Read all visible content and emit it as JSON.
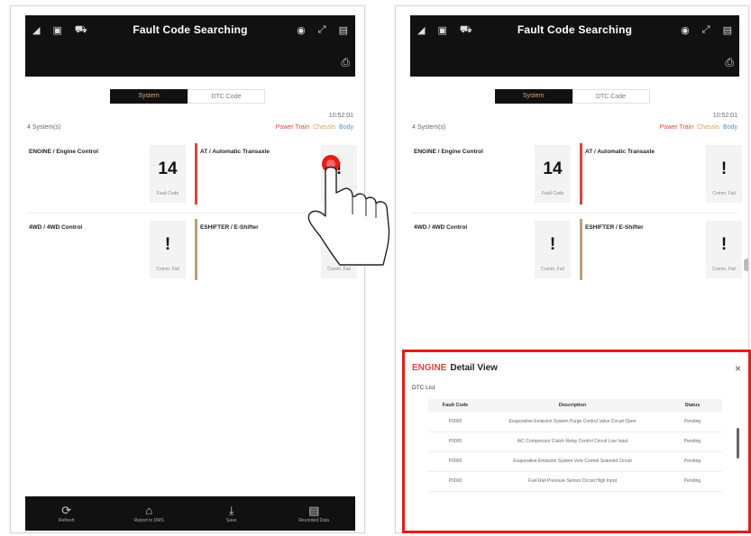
{
  "left_screen": {
    "title": "Fault Code Searching",
    "tabs": [
      {
        "label": "System"
      },
      {
        "label": "DTC Code"
      }
    ],
    "time": "10:52:01",
    "system_count": "4 System(s)",
    "filters": {
      "power": "Power Train",
      "chassis": "Chassis",
      "body": "Body"
    },
    "cards": [
      {
        "name": "ENGINE / Engine Control",
        "value": "14",
        "sub": "Fault Code"
      },
      {
        "name": "AT / Automatic Transaxle",
        "value": "!",
        "sub": "Comm. Fail"
      },
      {
        "name": "4WD / 4WD Control",
        "value": "!",
        "sub": "Comm. Fail"
      },
      {
        "name": "ESHIFTER / E-Shifter",
        "value": "!",
        "sub": "Comm. Fail"
      }
    ],
    "nav": [
      {
        "label": "Refresh"
      },
      {
        "label": "Report to DMS"
      },
      {
        "label": "Save"
      },
      {
        "label": "Recorded Data"
      }
    ]
  },
  "right_screen": {
    "title": "Fault Code Searching",
    "tabs": [
      {
        "label": "System"
      },
      {
        "label": "DTC Code"
      }
    ],
    "time": "10:52:01",
    "system_count": "4 System(s)",
    "filters": {
      "power": "Power Train",
      "chassis": "Chassis",
      "body": "Body"
    },
    "cards": [
      {
        "name": "ENGINE / Engine Control",
        "value": "14",
        "sub": "Fault Code"
      },
      {
        "name": "AT / Automatic Transaxle",
        "value": "!",
        "sub": "Comm. Fail"
      },
      {
        "name": "4WD / 4WD Control",
        "value": "!",
        "sub": "Comm. Fail"
      },
      {
        "name": "ESHIFTER / E-Shifter",
        "value": "!",
        "sub": "Comm. Fail"
      }
    ]
  },
  "detail": {
    "engine_label": "ENGINE",
    "title": "Detail View",
    "close": "×",
    "dtc_list_label": "DTC List",
    "columns": [
      "Fault Code",
      "Description",
      "Status"
    ],
    "rows": [
      {
        "code": "P0000",
        "desc": "Evaporative Emission System Purge Control Valve Circuit Open",
        "status": "Pending"
      },
      {
        "code": "P0000",
        "desc": "A/C Compressor Clutch Relay Control Circuit Low Input",
        "status": "Pending"
      },
      {
        "code": "P0000",
        "desc": "Evaporative Emission System Vent Control Solenoid Circuit",
        "status": "Pending"
      },
      {
        "code": "P0000",
        "desc": "Fuel Rail Pressure Sensor Circuit High Input",
        "status": "Pending"
      }
    ]
  },
  "colors": {
    "red_bar": "#d9463e",
    "tan_bar": "#b8a07a",
    "highlight_frame": "#e51c16",
    "power_train": "#d9463e",
    "chassis": "#c9a45c",
    "body": "#4a90c2"
  }
}
